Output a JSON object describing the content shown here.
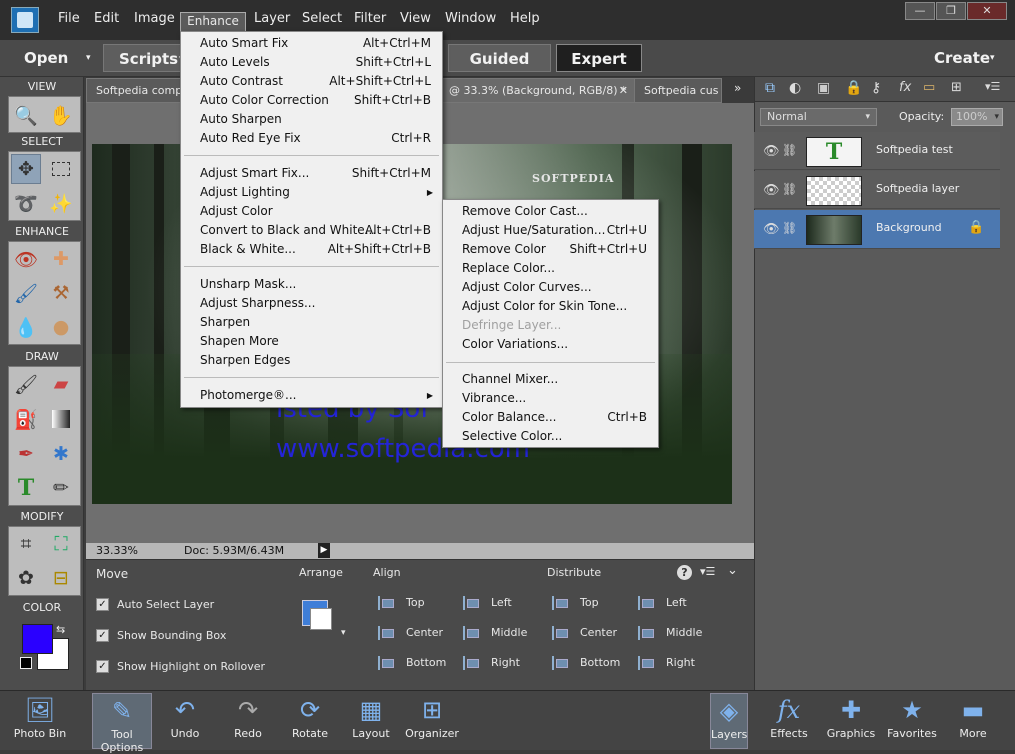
{
  "menubar": {
    "items": [
      "File",
      "Edit",
      "Image",
      "Enhance",
      "Layer",
      "Select",
      "Filter",
      "View",
      "Window",
      "Help"
    ],
    "active": "Enhance"
  },
  "modebar": {
    "open": "Open",
    "scripts": "Scripts",
    "guided": "Guided",
    "expert": "Expert",
    "create": "Create"
  },
  "tabs": [
    {
      "label": "Softpedia comp"
    },
    {
      "label": "@ 33.3% (Background, RGB/8) *"
    },
    {
      "label": "Softpedia cus"
    }
  ],
  "toolbox": {
    "view": "VIEW",
    "select": "SELECT",
    "enhance": "ENHANCE",
    "draw": "DRAW",
    "modify": "MODIFY",
    "color": "COLOR",
    "foreground_color": "#2a00ff",
    "background_color": "#ffffff"
  },
  "photo": {
    "label": "SOFTPEDIA",
    "overlay_line1": "isted by Sof",
    "overlay_line2": "www.softpedia.com"
  },
  "status": {
    "zoom": "33.33%",
    "doc": "Doc: 5.93M/6.43M"
  },
  "options": {
    "tool_name": "Move",
    "checkboxes": [
      {
        "label": "Auto Select Layer",
        "checked": true
      },
      {
        "label": "Show Bounding Box",
        "checked": true
      },
      {
        "label": "Show Highlight on Rollover",
        "checked": true
      }
    ],
    "arrange": "Arrange",
    "align": {
      "title": "Align",
      "items": [
        "Top",
        "Center",
        "Bottom",
        "Left",
        "Middle",
        "Right"
      ]
    },
    "distribute": {
      "title": "Distribute",
      "items": [
        "Top",
        "Center",
        "Bottom",
        "Left",
        "Middle",
        "Right"
      ]
    }
  },
  "layers": {
    "blend_mode": "Normal",
    "opacity_label": "Opacity:",
    "opacity_value": "100%",
    "items": [
      {
        "name": "Softpedia test",
        "type": "text"
      },
      {
        "name": "Softpedia layer",
        "type": "transparent"
      },
      {
        "name": "Background",
        "type": "image",
        "selected": true
      }
    ]
  },
  "bottombar": {
    "left": [
      {
        "label": "Photo Bin",
        "icon": "photo-bin-icon"
      },
      {
        "label": "Tool Options",
        "icon": "tool-options-icon"
      },
      {
        "label": "Undo",
        "icon": "undo-icon"
      },
      {
        "label": "Redo",
        "icon": "redo-icon"
      },
      {
        "label": "Rotate",
        "icon": "rotate-icon"
      },
      {
        "label": "Layout",
        "icon": "layout-icon"
      },
      {
        "label": "Organizer",
        "icon": "organizer-icon"
      }
    ],
    "right": [
      {
        "label": "Layers",
        "icon": "layers-icon"
      },
      {
        "label": "Effects",
        "icon": "effects-icon"
      },
      {
        "label": "Graphics",
        "icon": "graphics-icon"
      },
      {
        "label": "Favorites",
        "icon": "favorites-icon"
      },
      {
        "label": "More",
        "icon": "more-icon"
      }
    ]
  },
  "enhance_menu": {
    "items": [
      {
        "label": "Auto Smart Fix",
        "shortcut": "Alt+Ctrl+M"
      },
      {
        "label": "Auto Levels",
        "shortcut": "Shift+Ctrl+L"
      },
      {
        "label": "Auto Contrast",
        "shortcut": "Alt+Shift+Ctrl+L"
      },
      {
        "label": "Auto Color Correction",
        "shortcut": "Shift+Ctrl+B"
      },
      {
        "label": "Auto Sharpen",
        "shortcut": ""
      },
      {
        "label": "Auto Red Eye Fix",
        "shortcut": "Ctrl+R"
      },
      {
        "label": "Adjust Smart Fix...",
        "shortcut": "Shift+Ctrl+M"
      },
      {
        "label": "Adjust Lighting",
        "shortcut": ""
      },
      {
        "label": "Adjust Color",
        "shortcut": ""
      },
      {
        "label": "Convert to Black and White...",
        "shortcut": "Alt+Ctrl+B"
      },
      {
        "label": "Black & White...",
        "shortcut": "Alt+Shift+Ctrl+B"
      },
      {
        "label": "Unsharp Mask...",
        "shortcut": ""
      },
      {
        "label": "Adjust Sharpness...",
        "shortcut": ""
      },
      {
        "label": "Sharpen",
        "shortcut": ""
      },
      {
        "label": "Shapen More",
        "shortcut": ""
      },
      {
        "label": "Sharpen Edges",
        "shortcut": ""
      },
      {
        "label": "Photomerge®...",
        "shortcut": ""
      }
    ]
  },
  "color_submenu": {
    "items": [
      {
        "label": "Remove Color Cast...",
        "shortcut": ""
      },
      {
        "label": "Adjust Hue/Saturation...",
        "shortcut": "Ctrl+U"
      },
      {
        "label": "Remove Color",
        "shortcut": "Shift+Ctrl+U"
      },
      {
        "label": "Replace Color...",
        "shortcut": ""
      },
      {
        "label": "Adjust Color Curves...",
        "shortcut": ""
      },
      {
        "label": "Adjust Color for Skin Tone...",
        "shortcut": ""
      },
      {
        "label": "Defringe Layer...",
        "shortcut": "",
        "disabled": true
      },
      {
        "label": "Color Variations...",
        "shortcut": ""
      },
      {
        "label": "Channel Mixer...",
        "shortcut": ""
      },
      {
        "label": "Vibrance...",
        "shortcut": ""
      },
      {
        "label": "Color Balance...",
        "shortcut": "Ctrl+B"
      },
      {
        "label": "Selective Color...",
        "shortcut": ""
      }
    ]
  }
}
